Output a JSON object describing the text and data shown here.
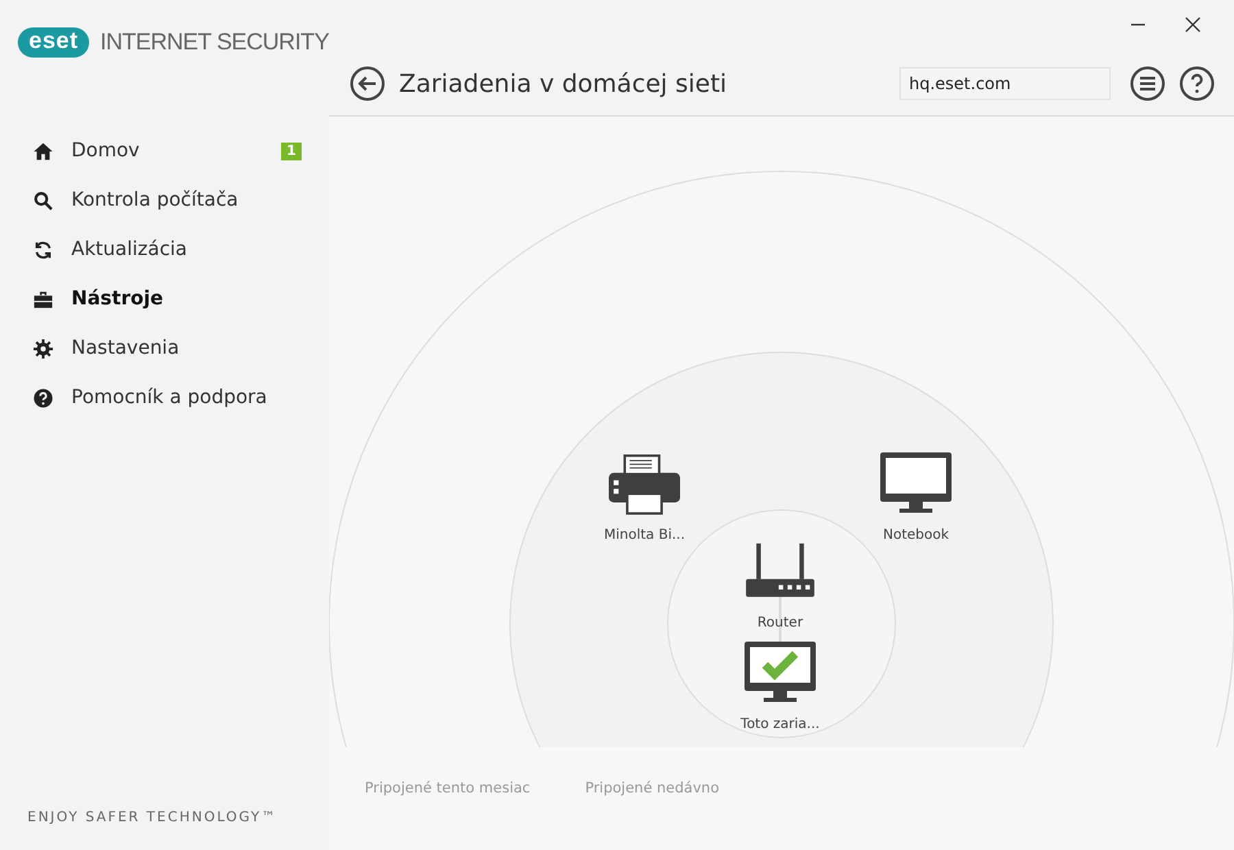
{
  "window": {
    "logo": "eset",
    "product": "INTERNET SECURITY"
  },
  "sidebar": {
    "items": [
      {
        "label": "Domov",
        "selected": false,
        "badge": "1"
      },
      {
        "label": "Kontrola počítača",
        "selected": false
      },
      {
        "label": "Aktualizácia",
        "selected": false
      },
      {
        "label": "Nástroje",
        "selected": true
      },
      {
        "label": "Nastavenia",
        "selected": false
      },
      {
        "label": "Pomocník a podpora",
        "selected": false
      }
    ],
    "tagline": "ENJOY SAFER TECHNOLOGY™"
  },
  "header": {
    "title": "Zariadenia v domácej sieti",
    "network_field": "hq.eset.com"
  },
  "devices": [
    {
      "kind": "printer",
      "label": "Minolta Bi...",
      "checked": false
    },
    {
      "kind": "monitor",
      "label": "Notebook",
      "checked": false
    },
    {
      "kind": "router",
      "label": "Router",
      "checked": false
    },
    {
      "kind": "monitor",
      "label": "Toto zaria...",
      "checked": true
    }
  ],
  "legend": [
    "Pripojené tento mesiac",
    "Pripojené nedávno"
  ]
}
